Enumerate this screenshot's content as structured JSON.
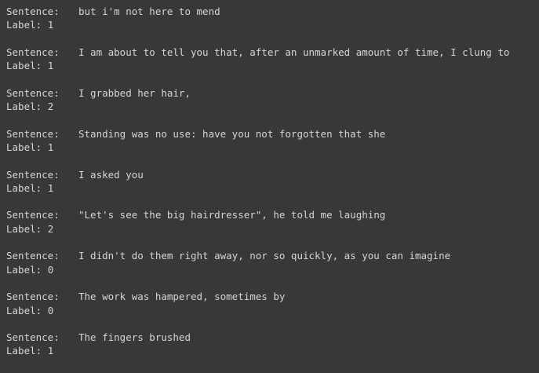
{
  "output": {
    "entries": [
      {
        "sentence_key": "Sentence:",
        "sentence": "but i'm not here to mend",
        "label_key": "Label:",
        "label": "1"
      },
      {
        "sentence_key": "Sentence:",
        "sentence": "I am about to tell you that, after an unmarked amount of time, I clung to",
        "label_key": "Label:",
        "label": "1"
      },
      {
        "sentence_key": "Sentence:",
        "sentence": "I grabbed her hair,",
        "label_key": "Label:",
        "label": "2"
      },
      {
        "sentence_key": "Sentence:",
        "sentence": "Standing was no use: have you not forgotten that she",
        "label_key": "Label:",
        "label": "1"
      },
      {
        "sentence_key": "Sentence:",
        "sentence": "I asked you",
        "label_key": "Label:",
        "label": "1"
      },
      {
        "sentence_key": "Sentence:",
        "sentence": "\"Let's see the big hairdresser\", he told me laughing",
        "label_key": "Label:",
        "label": "2"
      },
      {
        "sentence_key": "Sentence:",
        "sentence": "I didn't do them right away, nor so quickly, as you can imagine",
        "label_key": "Label:",
        "label": "0"
      },
      {
        "sentence_key": "Sentence:",
        "sentence": "The work was hampered, sometimes by",
        "label_key": "Label:",
        "label": "0"
      },
      {
        "sentence_key": "Sentence:",
        "sentence": "The fingers brushed",
        "label_key": "Label:",
        "label": "1"
      }
    ]
  },
  "colors": {
    "background": "#383838",
    "text": "#d5d5d5"
  }
}
